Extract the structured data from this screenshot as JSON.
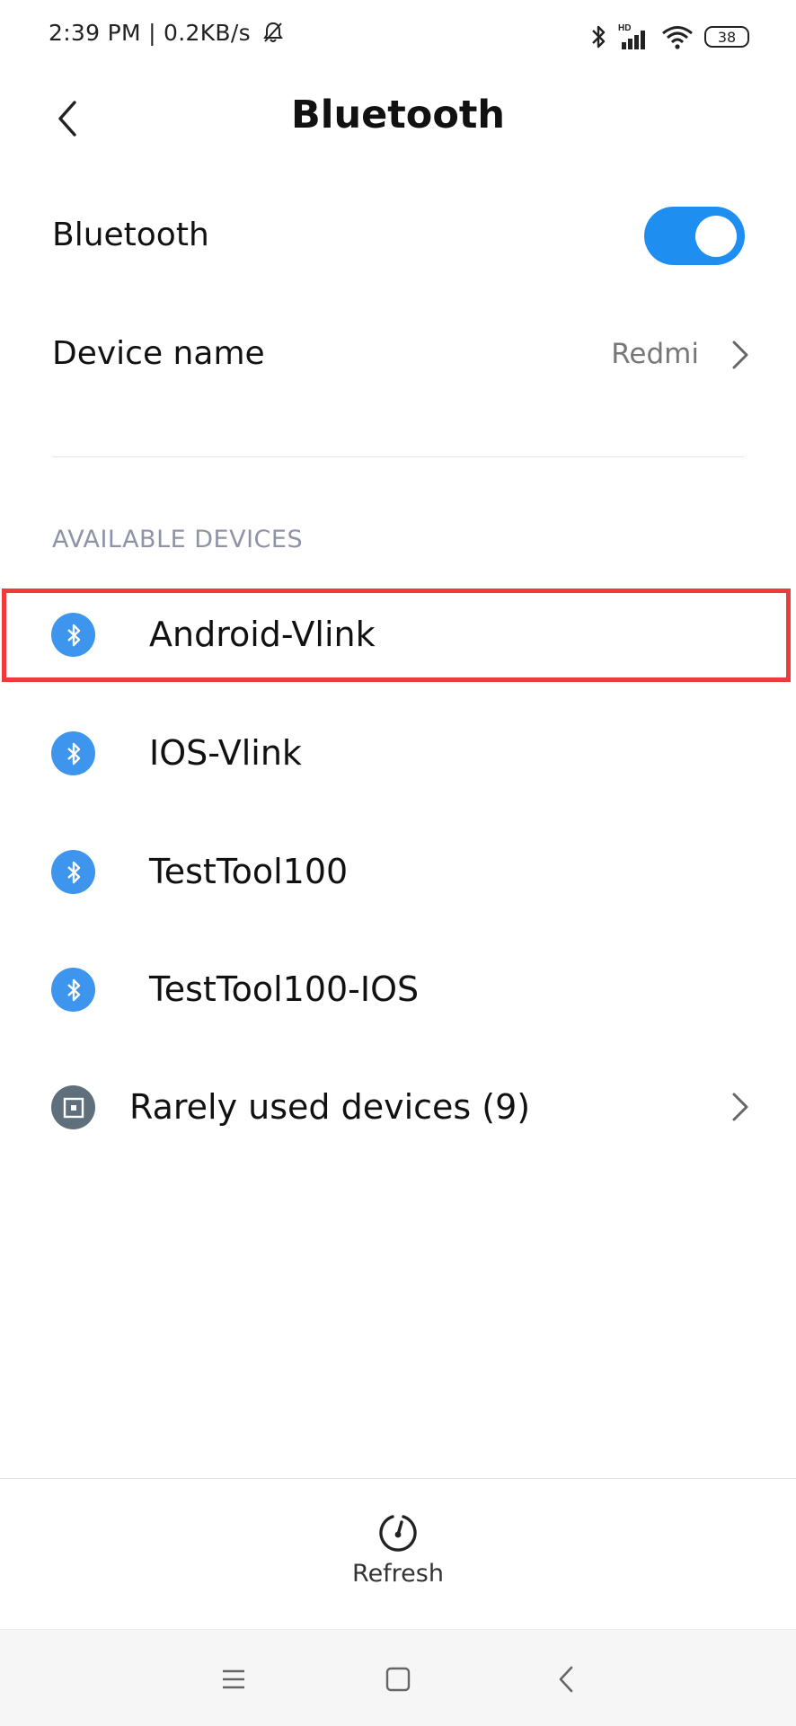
{
  "status_bar": {
    "time_speed": "2:39 PM | 0.2KB/s",
    "battery": "38",
    "network_tag": "HD",
    "icons": [
      "mute-bell-icon",
      "bluetooth-icon",
      "signal-icon",
      "wifi-icon",
      "battery-icon"
    ]
  },
  "header": {
    "title": "Bluetooth",
    "back_icon": "back-chevron-icon"
  },
  "bluetooth_row": {
    "label": "Bluetooth",
    "enabled": true,
    "accent": "#1f8ef1"
  },
  "device_name_row": {
    "label": "Device name",
    "value": "Redmi"
  },
  "available": {
    "header": "AVAILABLE DEVICES",
    "devices": [
      {
        "name": "Android-Vlink"
      },
      {
        "name": "IOS-Vlink"
      },
      {
        "name": "TestTool100"
      },
      {
        "name": "TestTool100-IOS"
      }
    ],
    "rarely_used": "Rarely used devices (9)"
  },
  "bottom": {
    "refresh_label": "Refresh"
  },
  "nav": {
    "icons": [
      "menu-icon",
      "home-icon",
      "back-icon"
    ]
  },
  "colors": {
    "badge": "#3d95ee",
    "highlight": "#ee3a3a",
    "section_header": "#8e94a6"
  }
}
